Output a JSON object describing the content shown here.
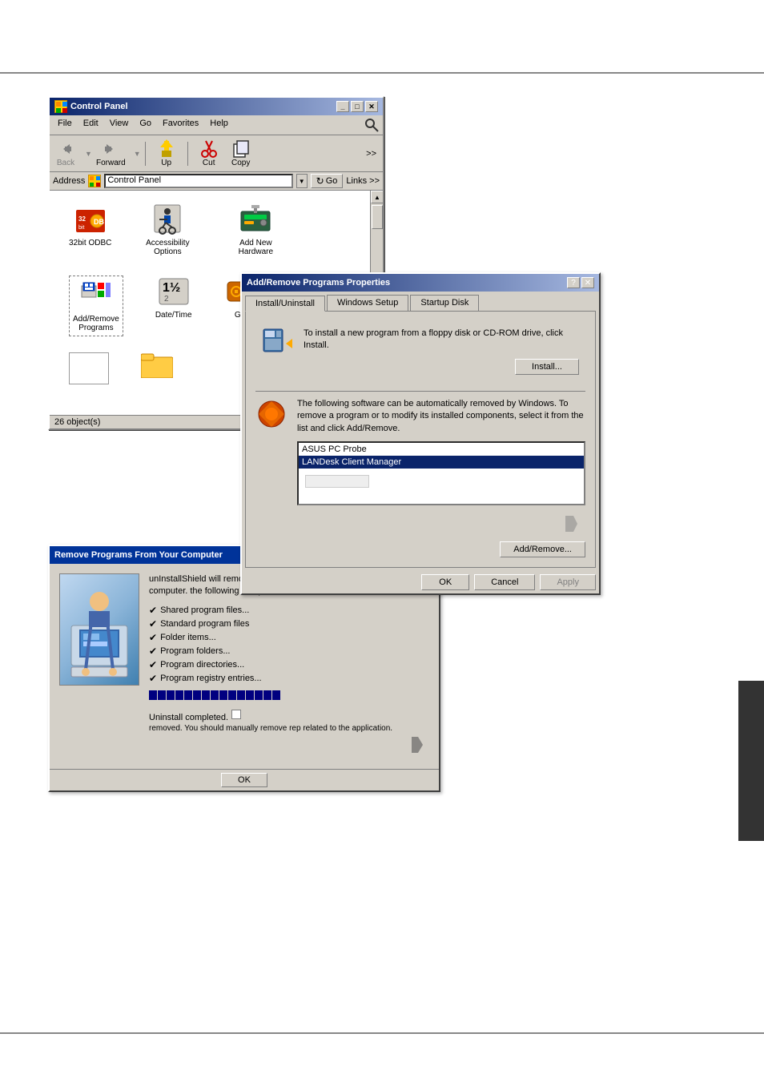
{
  "page": {
    "background": "#ffffff"
  },
  "control_panel": {
    "title": "Control Panel",
    "menu_items": [
      "File",
      "Edit",
      "View",
      "Go",
      "Favorites",
      "Help"
    ],
    "toolbar": {
      "back_label": "Back",
      "forward_label": "Forward",
      "up_label": "Up",
      "cut_label": "Cut",
      "copy_label": "Copy",
      "more_label": ">>"
    },
    "address_bar": {
      "label": "Address",
      "value": "Control Panel",
      "go_label": "Go",
      "links_label": "Links >>"
    },
    "icons": [
      {
        "label": "32bit ODBC",
        "type": "odbc"
      },
      {
        "label": "Accessibility Options",
        "type": "accessibility"
      },
      {
        "label": "Add New Hardware",
        "type": "hardware"
      },
      {
        "label": "Add/Remove Programs",
        "type": "addremove"
      },
      {
        "label": "Date/Time",
        "type": "datetime"
      },
      {
        "label": "Ga",
        "type": "folder"
      }
    ],
    "status": "26 object(s)"
  },
  "add_remove_dialog": {
    "title": "Add/Remove Programs Properties",
    "tabs": [
      "Install/Uninstall",
      "Windows Setup",
      "Startup Disk"
    ],
    "active_tab": "Install/Uninstall",
    "install_section": {
      "text": "To install a new program from a floppy disk or CD-ROM drive, click Install.",
      "button": "Install..."
    },
    "software_section": {
      "text": "The following software can be automatically removed by Windows. To remove a program or to modify its installed components, select it from the list and click Add/Remove.",
      "items": [
        "ASUS PC Probe",
        "LANDesk Client Manager"
      ],
      "selected": "LANDesk Client Manager",
      "button": "Add/Remove..."
    },
    "buttons": {
      "ok": "OK",
      "cancel": "Cancel",
      "apply": "Apply"
    }
  },
  "remove_dialog": {
    "title": "Remove Programs From Your Computer",
    "description": "unInstallShield will remove the LANDesk Client Manager from your computer. the following components is rem",
    "checklist": [
      "Shared program files...",
      "Standard program files",
      "Folder items...",
      "Program folders...",
      "Program directories...",
      "Program registry entries..."
    ],
    "uninstall_text": "Uninstall completed.",
    "uninstall_sub": "removed. You should manually remove rep related to the application.",
    "ok_button": "OK"
  }
}
